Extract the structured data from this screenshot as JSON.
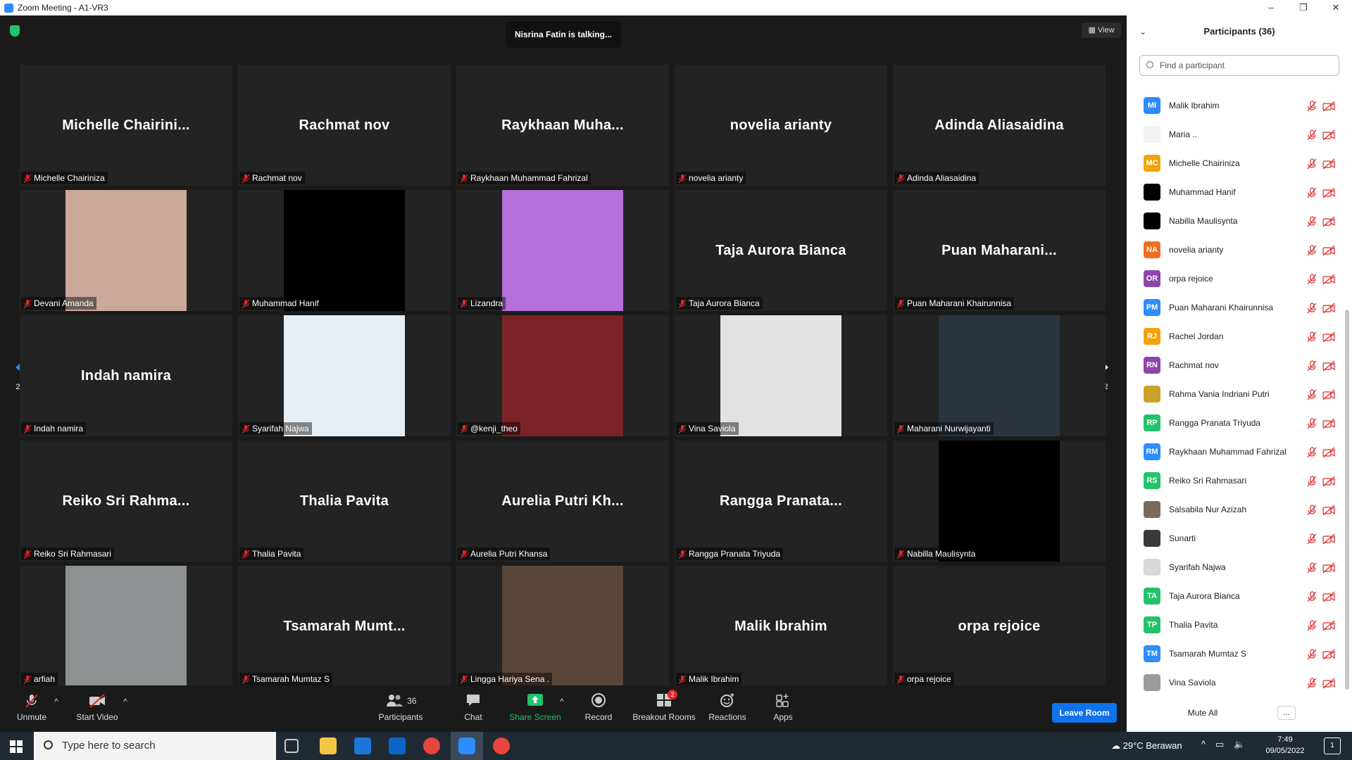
{
  "window": {
    "title": "Zoom Meeting - A1-VR3",
    "controls": [
      "–",
      "❐",
      "✕"
    ]
  },
  "meeting": {
    "talking_indicator": "Nisrina Fatin is talking...",
    "view_label": "View",
    "page_indicator": "2/2",
    "tiles": [
      {
        "big": "Michelle  Chairini...",
        "label": "Michelle Chairiniza",
        "photo": null
      },
      {
        "big": "Rachmat nov",
        "label": "Rachmat nov",
        "photo": null
      },
      {
        "big": "Raykhaan  Muha...",
        "label": "Raykhaan Muhammad Fahrizal",
        "photo": null
      },
      {
        "big": "novelia arianty",
        "label": "novelia arianty",
        "photo": null
      },
      {
        "big": "Adinda Aliasaidina",
        "label": "Adinda Aliasaidina",
        "photo": null
      },
      {
        "big": "",
        "label": "Devani Amanda",
        "photo": "#c9a89a"
      },
      {
        "big": "",
        "label": "Muhammad Hanif",
        "photo": "#000000"
      },
      {
        "big": "",
        "label": "Lizandra",
        "photo": "#b46fd8"
      },
      {
        "big": "Taja Aurora Bianca",
        "label": "Taja Aurora Bianca",
        "photo": null
      },
      {
        "big": "Puan  Maharani...",
        "label": "Puan Maharani Khairunnisa",
        "photo": null
      },
      {
        "big": "Indah namira",
        "label": "Indah namira",
        "photo": null
      },
      {
        "big": "",
        "label": "Syarifah Najwa",
        "photo": "#e7eef3"
      },
      {
        "big": "",
        "label": "@kenji_theo",
        "photo": "#7a2328"
      },
      {
        "big": "",
        "label": "Vina Saviola",
        "photo": "#e2e2e2"
      },
      {
        "big": "",
        "label": "Maharani Nurwijayanti",
        "photo": "#2b3341"
      },
      {
        "big": "Reiko  Sri  Rahma...",
        "label": "Reiko Sri Rahmasari",
        "photo": null
      },
      {
        "big": "Thalia Pavita",
        "label": "Thalia Pavita",
        "photo": null
      },
      {
        "big": "Aurelia  Putri  Kh...",
        "label": "Aurelia Putri Khansa",
        "photo": null
      },
      {
        "big": "Rangga  Pranata...",
        "label": "Rangga Pranata Triyuda",
        "photo": null
      },
      {
        "big": "",
        "label": "Nabilla Maulisynta",
        "photo": "#000000"
      },
      {
        "big": "",
        "label": "arfiah",
        "photo": "#8e9292"
      },
      {
        "big": "Tsamarah  Mumt...",
        "label": "Tsamarah Mumtaz S",
        "photo": null
      },
      {
        "big": "",
        "label": "Lingga Hariya Sena .",
        "photo": "#5a4638"
      },
      {
        "big": "Malik Ibrahim",
        "label": "Malik Ibrahim",
        "photo": null
      },
      {
        "big": "orpa rejoice",
        "label": "orpa rejoice",
        "photo": null
      }
    ]
  },
  "toolbar": {
    "unmute": "Unmute",
    "start_video": "Start Video",
    "participants": "Participants",
    "participants_count": "36",
    "chat": "Chat",
    "share_screen": "Share Screen",
    "record": "Record",
    "breakout_rooms": "Breakout Rooms",
    "breakout_badge": "2",
    "reactions": "Reactions",
    "apps": "Apps",
    "leave": "Leave Room"
  },
  "panel": {
    "title": "Participants (36)",
    "search_placeholder": "Find a participant",
    "mute_all": "Mute All",
    "more": "...",
    "participants": [
      {
        "initials": "MI",
        "name": "Malik Ibrahim",
        "color": "#2d8cff"
      },
      {
        "initials": "",
        "name": "Maria ..",
        "color": "#f2f2f2"
      },
      {
        "initials": "MC",
        "name": "Michelle Chairiniza",
        "color": "#f0a30a"
      },
      {
        "initials": "",
        "name": "Muhammad Hanif",
        "color": "#000000"
      },
      {
        "initials": "",
        "name": "Nabilla Maulisynta",
        "color": "#000000"
      },
      {
        "initials": "NA",
        "name": "novelia arianty",
        "color": "#f26d21"
      },
      {
        "initials": "OR",
        "name": "orpa rejoice",
        "color": "#8e44ad"
      },
      {
        "initials": "PM",
        "name": "Puan Maharani Khairunnisa",
        "color": "#2d8cff"
      },
      {
        "initials": "RJ",
        "name": "Rachel Jordan",
        "color": "#f0a30a"
      },
      {
        "initials": "RN",
        "name": "Rachmat nov",
        "color": "#8e44ad"
      },
      {
        "initials": "",
        "name": "Rahma Vania Indriani Putri",
        "color": "#c9a227"
      },
      {
        "initials": "RP",
        "name": "Rangga Pranata Triyuda",
        "color": "#23c26b"
      },
      {
        "initials": "RM",
        "name": "Raykhaan Muhammad Fahrizal",
        "color": "#2d8cff"
      },
      {
        "initials": "RS",
        "name": "Reiko Sri Rahmasari",
        "color": "#23c26b"
      },
      {
        "initials": "",
        "name": "Salsabila Nur Azizah",
        "color": "#7a6a5a"
      },
      {
        "initials": "",
        "name": "Sunarti",
        "color": "#3a3a3a"
      },
      {
        "initials": "",
        "name": "Syarifah Najwa",
        "color": "#d9d9d9"
      },
      {
        "initials": "TA",
        "name": "Taja Aurora Bianca",
        "color": "#23c26b"
      },
      {
        "initials": "TP",
        "name": "Thalia Pavita",
        "color": "#23c26b"
      },
      {
        "initials": "TM",
        "name": "Tsamarah Mumtaz S",
        "color": "#2d8cff"
      },
      {
        "initials": "",
        "name": "Vina Saviola",
        "color": "#9a9a9a"
      }
    ]
  },
  "taskbar": {
    "search_placeholder": "Type here to search",
    "weather": "29°C  Berawan",
    "time": "7:49",
    "date": "09/05/2022",
    "notification_count": "1"
  }
}
